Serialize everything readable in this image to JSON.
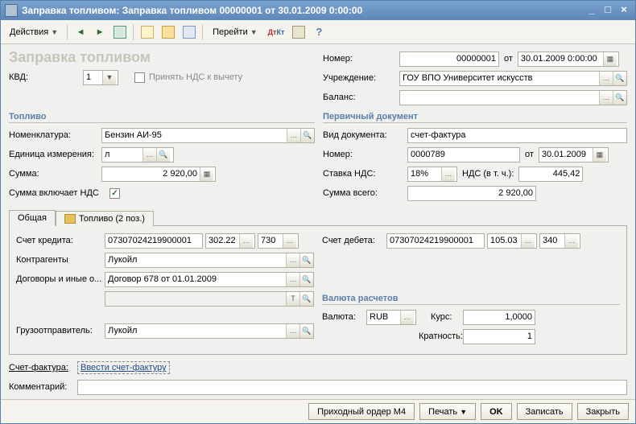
{
  "window": {
    "title": "Заправка топливом: Заправка топливом 00000001 от 30.01.2009 0:00:00"
  },
  "toolbar": {
    "actions": "Действия",
    "goto": "Перейти"
  },
  "big_title": "Заправка топливом",
  "header": {
    "kvd": "КВД:",
    "kvd_val": "1",
    "nds_chk_label": "Принять НДС к вычету",
    "number_lbl": "Номер:",
    "number_val": "00000001",
    "ot": "от",
    "date_val": "30.01.2009 0:00:00",
    "uchr_lbl": "Учреждение:",
    "uchr_val": "ГОУ ВПО Университет искусств",
    "balance_lbl": "Баланс:",
    "balance_val": ""
  },
  "fuel": {
    "section": "Топливо",
    "nomen_lbl": "Номенклатура:",
    "nomen_val": "Бензин АИ-95",
    "ed_lbl": "Единица измерения:",
    "ed_val": "л",
    "sum_lbl": "Сумма:",
    "sum_val": "2 920,00",
    "sum_incl": "Сумма включает НДС"
  },
  "prim": {
    "section": "Первичный документ",
    "type_lbl": "Вид документа:",
    "type_val": "счет-фактура",
    "num_lbl": "Номер:",
    "num_val": "0000789",
    "ot": "от",
    "date_val": "30.01.2009",
    "rate_lbl": "Ставка НДС:",
    "rate_val": "18%",
    "nds_lbl": "НДС (в т. ч.):",
    "nds_val": "445,42",
    "total_lbl": "Сумма всего:",
    "total_val": "2 920,00"
  },
  "tabs": {
    "general": "Общая",
    "fuel": "Топливо (2 поз.)"
  },
  "accounts": {
    "credit_lbl": "Счет кредита:",
    "credit_acc": "07307024219900001",
    "credit_sub": "302.22",
    "credit_code": "730",
    "debit_lbl": "Счет дебета:",
    "debit_acc": "07307024219900001",
    "debit_sub": "105.03",
    "debit_code": "340",
    "counter_lbl": "Контрагенты",
    "counter_val": "Лукойл",
    "contract_lbl": "Договоры и иные о...",
    "contract_val": "Договор 678 от 01.01.2009",
    "shipper_lbl": "Грузоотправитель:",
    "shipper_val": "Лукойл"
  },
  "currency": {
    "section": "Валюта расчетов",
    "cur_lbl": "Валюта:",
    "cur_val": "RUB",
    "rate_lbl": "Курс:",
    "rate_val": "1,0000",
    "mult_lbl": "Кратность:",
    "mult_val": "1"
  },
  "bottom": {
    "sf_lbl": "Счет-фактура:",
    "sf_link": "Ввести счет-фактуру",
    "comment_lbl": "Комментарий:",
    "comment_val": ""
  },
  "footer": {
    "m4": "Приходный ордер М4",
    "print": "Печать",
    "ok": "OK",
    "write": "Записать",
    "close": "Закрыть"
  }
}
